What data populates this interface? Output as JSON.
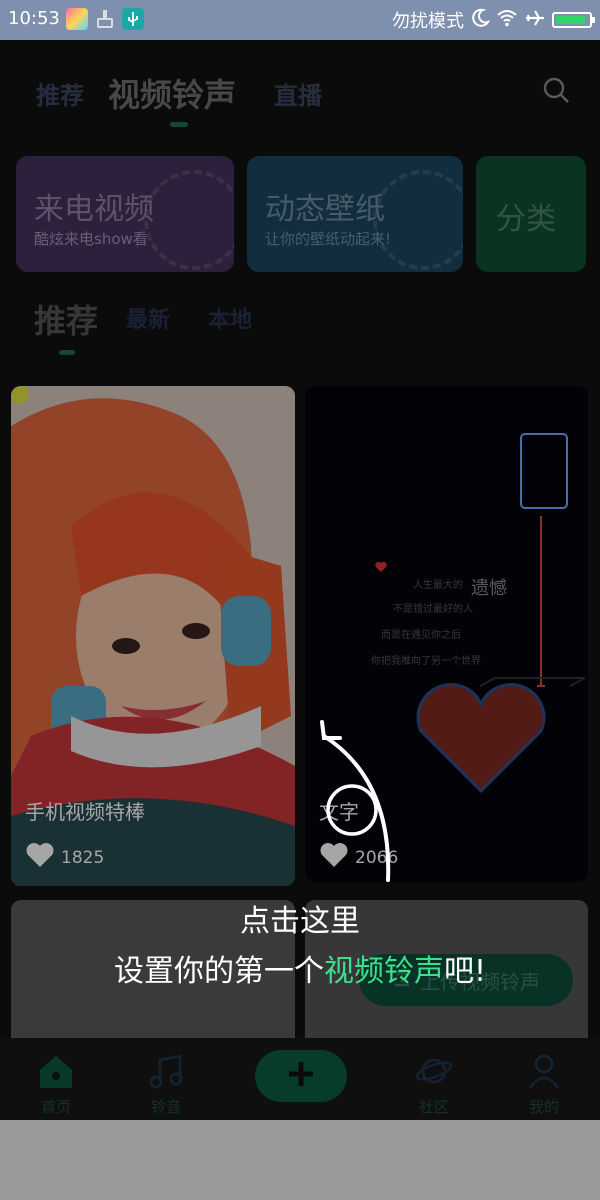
{
  "status_bar": {
    "time": "10:53",
    "dnd_text": "勿扰模式",
    "battery_level": 0.9,
    "battery_color": "#31d36a"
  },
  "top_nav": {
    "tabs": [
      "推荐",
      "视频铃声",
      "直播"
    ],
    "active_tab": "视频铃声",
    "search_icon": "search-icon"
  },
  "feature_cards": [
    {
      "title": "来电视频",
      "subtitle": "酷炫来电show看",
      "color": "#46325d"
    },
    {
      "title": "动态壁纸",
      "subtitle": "让你的壁纸动起来!",
      "color": "#1d4660"
    },
    {
      "title": "分类",
      "color": "#0d5133"
    }
  ],
  "sub_tabs": [
    "推荐",
    "最新",
    "本地"
  ],
  "videos": [
    {
      "title": "手机视频特棒",
      "likes": "1825"
    },
    {
      "title": "文字",
      "likes": "2066",
      "poem": [
        "人生最大的",
        "不是错过最好的人",
        "而是在遇见你之后",
        "你把我推向了另一个世界"
      ],
      "heading": "遗憾"
    },
    {
      "upload_label": "上传视频铃声"
    }
  ],
  "bottom_nav": [
    {
      "label": "首页",
      "icon": "home-icon"
    },
    {
      "label": "铃音",
      "icon": "music-note-icon"
    },
    {
      "icon": "plus-icon"
    },
    {
      "label": "社区",
      "icon": "planet-icon"
    },
    {
      "label": "我的",
      "icon": "user-icon"
    }
  ],
  "tutorial_overlay": {
    "line1": "点击这里",
    "line2_prefix": "设置你的第一个",
    "line2_highlight": "视频铃声",
    "line2_suffix": "吧!"
  },
  "colors": {
    "accent_green": "#3be08e",
    "app_background": "#121212"
  }
}
